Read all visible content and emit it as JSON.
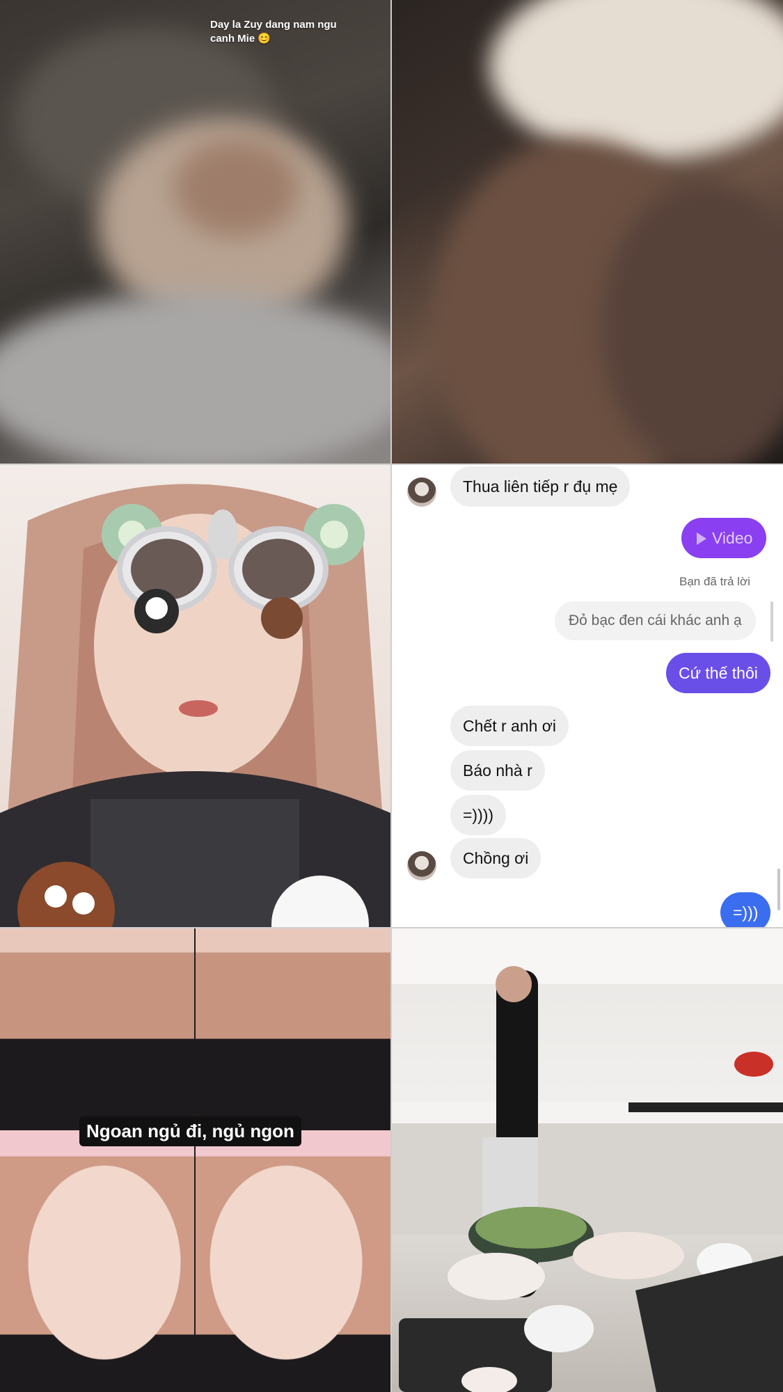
{
  "panel1": {
    "caption": "Day la Zuy dang nam ngu canh Mie 😊"
  },
  "chat": {
    "messages": [
      {
        "text": "Thua liên tiếp r đụ mẹ"
      },
      {
        "video_label": "Video",
        "video_color": "#8a3ff0"
      },
      {
        "reply_label": "Bạn đã trả lời",
        "reply_quote": "Đỏ bạc đen cái khác anh ạ"
      },
      {
        "text": "Cứ thế thôi",
        "color": "#6a4ee8"
      },
      {
        "text": "Chết r anh ơi"
      },
      {
        "text": "Báo nhà r"
      },
      {
        "text": "=))))"
      },
      {
        "text": "Chồng ơi"
      },
      {
        "text": "=)))",
        "color": "#3b6df0"
      }
    ]
  },
  "panel5": {
    "overlay": "Ngoan ngủ đi, ngủ ngon"
  }
}
